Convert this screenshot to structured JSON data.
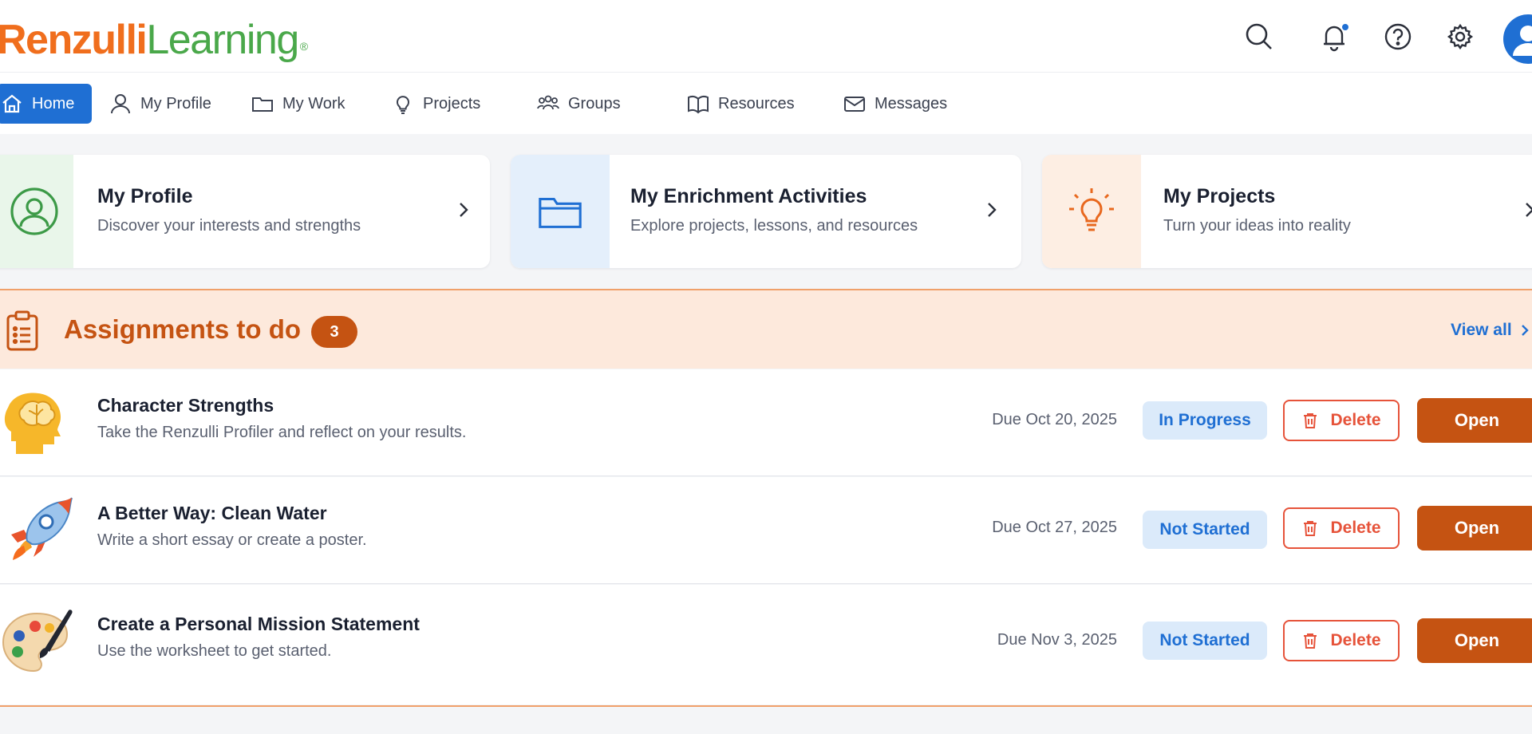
{
  "brand": {
    "name_part1": "Renzulli",
    "name_part2": "Learning",
    "reg": "®"
  },
  "header_icons": [
    "search-icon",
    "bell-icon",
    "help-icon",
    "gear-icon",
    "avatar"
  ],
  "nav": {
    "items": [
      {
        "label": "Home",
        "icon": "home-icon",
        "active": true
      },
      {
        "label": "My Profile",
        "icon": "user-icon"
      },
      {
        "label": "My Work",
        "icon": "folder-icon"
      },
      {
        "label": "Projects",
        "icon": "lightbulb-icon"
      },
      {
        "label": "Groups",
        "icon": "groups-icon"
      },
      {
        "label": "Resources",
        "icon": "book-icon"
      },
      {
        "label": "Messages",
        "icon": "mail-icon"
      }
    ]
  },
  "cards": [
    {
      "title": "My Profile",
      "subtitle": "Discover your interests and strengths",
      "icon": "profile-circle-icon",
      "tint": "#e9f6ea",
      "accent": "#3c9a47"
    },
    {
      "title": "My Enrichment Activities",
      "subtitle": "Explore projects, lessons, and resources",
      "icon": "folder-icon",
      "tint": "#e4effb",
      "accent": "#1f6fd3"
    },
    {
      "title": "My Projects",
      "subtitle": "Turn your ideas into reality",
      "icon": "lightbulb-icon",
      "tint": "#fdeee3",
      "accent": "#e8681e"
    }
  ],
  "assignments": {
    "title": "Assignments to do",
    "count": "3",
    "view_all": "View all",
    "delete_label": "Delete",
    "open_label": "Open",
    "items": [
      {
        "title": "Character Strengths",
        "description": "Take the Renzulli Profiler and reflect on your results.",
        "due": "Due Oct 20, 2025",
        "status": "In Progress",
        "icon": "brain-head-icon"
      },
      {
        "title": "A Better Way: Clean Water",
        "description": "Write a short essay or create a poster.",
        "due": "Due Oct 27, 2025",
        "status": "Not Started",
        "icon": "rocket-icon"
      },
      {
        "title": "Create a Personal Mission Statement",
        "description": "Use the worksheet to get started.",
        "due": "Due Nov 3, 2025",
        "status": "Not Started",
        "icon": "palette-icon"
      }
    ]
  },
  "colors": {
    "primary": "#1f6fd3",
    "accent_orange": "#c55312",
    "danger": "#e6533a",
    "header_band": "#fde9dc"
  }
}
